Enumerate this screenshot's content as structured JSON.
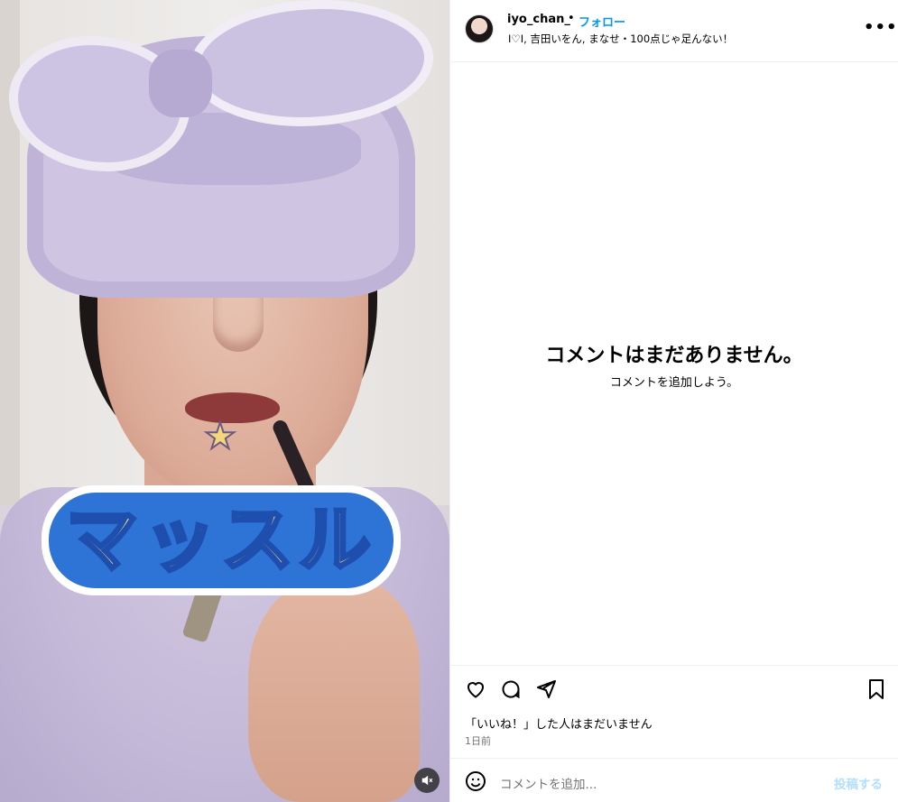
{
  "media": {
    "sticker_text": "マッスル",
    "star_glyph": "★",
    "mute_icon": "volume-muted-icon"
  },
  "header": {
    "username": "iyo_chan_",
    "separator": "•",
    "follow_label": "フォロー",
    "audio": "I♡I, 吉田いをん, まなせ・100点じゃ足んない！",
    "more_icon": "more-options-icon"
  },
  "comments": {
    "empty_title": "コメントはまだありません。",
    "empty_subtitle": "コメントを追加しよう。"
  },
  "actions": {
    "like_icon": "heart-icon",
    "comment_icon": "comment-icon",
    "share_icon": "send-icon",
    "save_icon": "bookmark-icon"
  },
  "likes_text": "「いいね！」した人はまだいません",
  "timestamp": "1日前",
  "comment_bar": {
    "emoji_icon": "emoji-icon",
    "placeholder": "コメントを追加...",
    "post_label": "投稿する"
  },
  "colors": {
    "link_blue": "#0095f6",
    "post_disabled": "#b2dffc",
    "muted_text": "#737373",
    "divider": "#efefef"
  }
}
